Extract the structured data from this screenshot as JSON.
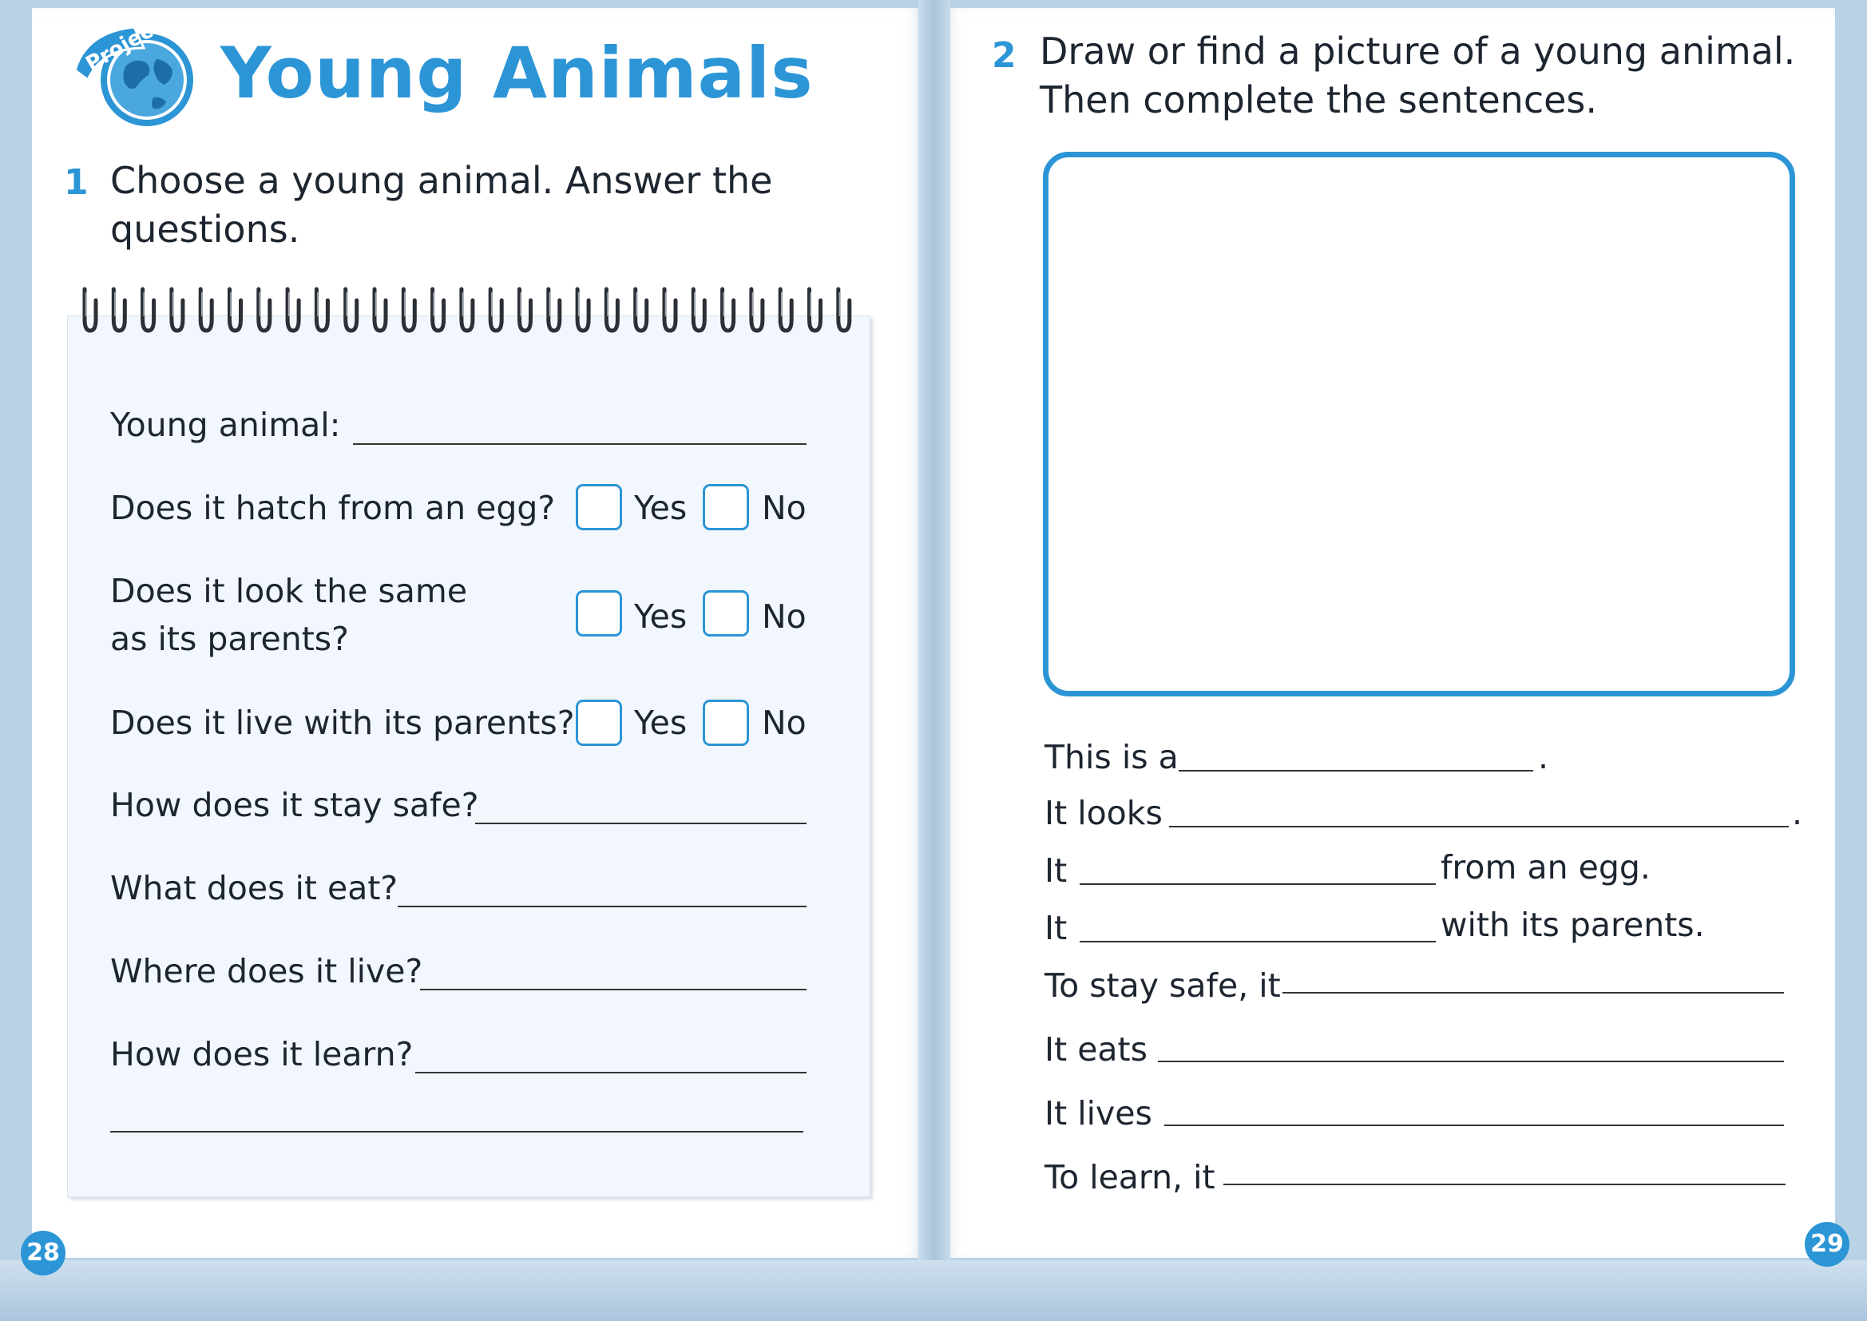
{
  "title": "Young Animals",
  "badge_label": "Project",
  "left_page": {
    "question_number": "1",
    "question_text_line1": "Choose a young animal. Answer the",
    "question_text_line2": "questions.",
    "notebook": {
      "young_animal_label": "Young animal:",
      "hatch_question": "Does it hatch from an egg?",
      "look_same_line1": "Does it look the same",
      "look_same_line2": "as its parents?",
      "live_with_parents_question": "Does it live with its parents?",
      "stay_safe_question": "How does it stay safe?",
      "eat_question": "What does it eat?",
      "live_where_question": "Where does it live?",
      "learn_question": "How does it learn?",
      "yes_label": "Yes",
      "no_label": "No"
    },
    "page_number": "28"
  },
  "right_page": {
    "question_number": "2",
    "question_text_line1": "Draw or find a picture of a young animal.",
    "question_text_line2": "Then complete the sentences.",
    "sentences": {
      "this_is_a": "This is a",
      "it_looks": "It looks",
      "it_1": "It",
      "from_an_egg": "from an egg.",
      "it_2": "It",
      "with_its_parents": "with its parents.",
      "to_stay_safe": "To stay safe, it",
      "it_eats": "It eats",
      "it_lives": "It lives",
      "to_learn": "To learn, it",
      "period": "."
    },
    "page_number": "29"
  },
  "colors": {
    "accent": "#2c95d6",
    "text": "#1d2530",
    "notebook_bg": "#f1f7fc"
  }
}
